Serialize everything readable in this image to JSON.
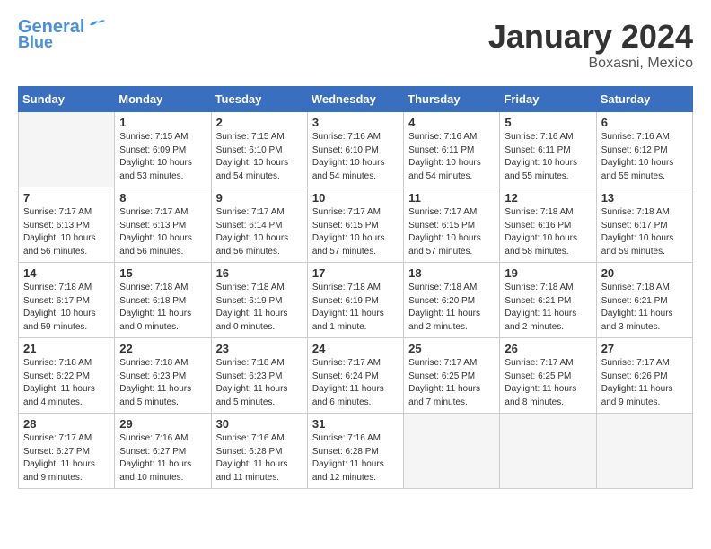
{
  "header": {
    "logo_line1": "General",
    "logo_line2": "Blue",
    "title": "January 2024",
    "subtitle": "Boxasni, Mexico"
  },
  "columns": [
    "Sunday",
    "Monday",
    "Tuesday",
    "Wednesday",
    "Thursday",
    "Friday",
    "Saturday"
  ],
  "weeks": [
    [
      {
        "day": "",
        "info": ""
      },
      {
        "day": "1",
        "info": "Sunrise: 7:15 AM\nSunset: 6:09 PM\nDaylight: 10 hours\nand 53 minutes."
      },
      {
        "day": "2",
        "info": "Sunrise: 7:15 AM\nSunset: 6:10 PM\nDaylight: 10 hours\nand 54 minutes."
      },
      {
        "day": "3",
        "info": "Sunrise: 7:16 AM\nSunset: 6:10 PM\nDaylight: 10 hours\nand 54 minutes."
      },
      {
        "day": "4",
        "info": "Sunrise: 7:16 AM\nSunset: 6:11 PM\nDaylight: 10 hours\nand 54 minutes."
      },
      {
        "day": "5",
        "info": "Sunrise: 7:16 AM\nSunset: 6:11 PM\nDaylight: 10 hours\nand 55 minutes."
      },
      {
        "day": "6",
        "info": "Sunrise: 7:16 AM\nSunset: 6:12 PM\nDaylight: 10 hours\nand 55 minutes."
      }
    ],
    [
      {
        "day": "7",
        "info": "Sunrise: 7:17 AM\nSunset: 6:13 PM\nDaylight: 10 hours\nand 56 minutes."
      },
      {
        "day": "8",
        "info": "Sunrise: 7:17 AM\nSunset: 6:13 PM\nDaylight: 10 hours\nand 56 minutes."
      },
      {
        "day": "9",
        "info": "Sunrise: 7:17 AM\nSunset: 6:14 PM\nDaylight: 10 hours\nand 56 minutes."
      },
      {
        "day": "10",
        "info": "Sunrise: 7:17 AM\nSunset: 6:15 PM\nDaylight: 10 hours\nand 57 minutes."
      },
      {
        "day": "11",
        "info": "Sunrise: 7:17 AM\nSunset: 6:15 PM\nDaylight: 10 hours\nand 57 minutes."
      },
      {
        "day": "12",
        "info": "Sunrise: 7:18 AM\nSunset: 6:16 PM\nDaylight: 10 hours\nand 58 minutes."
      },
      {
        "day": "13",
        "info": "Sunrise: 7:18 AM\nSunset: 6:17 PM\nDaylight: 10 hours\nand 59 minutes."
      }
    ],
    [
      {
        "day": "14",
        "info": "Sunrise: 7:18 AM\nSunset: 6:17 PM\nDaylight: 10 hours\nand 59 minutes."
      },
      {
        "day": "15",
        "info": "Sunrise: 7:18 AM\nSunset: 6:18 PM\nDaylight: 11 hours\nand 0 minutes."
      },
      {
        "day": "16",
        "info": "Sunrise: 7:18 AM\nSunset: 6:19 PM\nDaylight: 11 hours\nand 0 minutes."
      },
      {
        "day": "17",
        "info": "Sunrise: 7:18 AM\nSunset: 6:19 PM\nDaylight: 11 hours\nand 1 minute."
      },
      {
        "day": "18",
        "info": "Sunrise: 7:18 AM\nSunset: 6:20 PM\nDaylight: 11 hours\nand 2 minutes."
      },
      {
        "day": "19",
        "info": "Sunrise: 7:18 AM\nSunset: 6:21 PM\nDaylight: 11 hours\nand 2 minutes."
      },
      {
        "day": "20",
        "info": "Sunrise: 7:18 AM\nSunset: 6:21 PM\nDaylight: 11 hours\nand 3 minutes."
      }
    ],
    [
      {
        "day": "21",
        "info": "Sunrise: 7:18 AM\nSunset: 6:22 PM\nDaylight: 11 hours\nand 4 minutes."
      },
      {
        "day": "22",
        "info": "Sunrise: 7:18 AM\nSunset: 6:23 PM\nDaylight: 11 hours\nand 5 minutes."
      },
      {
        "day": "23",
        "info": "Sunrise: 7:18 AM\nSunset: 6:23 PM\nDaylight: 11 hours\nand 5 minutes."
      },
      {
        "day": "24",
        "info": "Sunrise: 7:17 AM\nSunset: 6:24 PM\nDaylight: 11 hours\nand 6 minutes."
      },
      {
        "day": "25",
        "info": "Sunrise: 7:17 AM\nSunset: 6:25 PM\nDaylight: 11 hours\nand 7 minutes."
      },
      {
        "day": "26",
        "info": "Sunrise: 7:17 AM\nSunset: 6:25 PM\nDaylight: 11 hours\nand 8 minutes."
      },
      {
        "day": "27",
        "info": "Sunrise: 7:17 AM\nSunset: 6:26 PM\nDaylight: 11 hours\nand 9 minutes."
      }
    ],
    [
      {
        "day": "28",
        "info": "Sunrise: 7:17 AM\nSunset: 6:27 PM\nDaylight: 11 hours\nand 9 minutes."
      },
      {
        "day": "29",
        "info": "Sunrise: 7:16 AM\nSunset: 6:27 PM\nDaylight: 11 hours\nand 10 minutes."
      },
      {
        "day": "30",
        "info": "Sunrise: 7:16 AM\nSunset: 6:28 PM\nDaylight: 11 hours\nand 11 minutes."
      },
      {
        "day": "31",
        "info": "Sunrise: 7:16 AM\nSunset: 6:28 PM\nDaylight: 11 hours\nand 12 minutes."
      },
      {
        "day": "",
        "info": ""
      },
      {
        "day": "",
        "info": ""
      },
      {
        "day": "",
        "info": ""
      }
    ]
  ]
}
